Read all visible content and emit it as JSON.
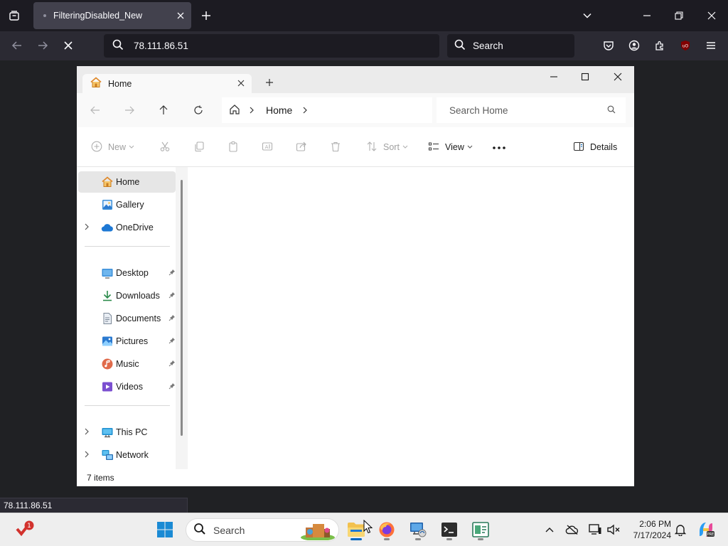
{
  "browser": {
    "tab_title": "FilteringDisabled_New",
    "url": "78.111.86.51",
    "search_placeholder": "Search",
    "status_url": "78.111.86.51"
  },
  "explorer": {
    "tab_title": "Home",
    "breadcrumb": "Home",
    "search_placeholder": "Search Home",
    "commands": {
      "new": "New",
      "sort": "Sort",
      "view": "View",
      "details": "Details"
    },
    "nav": {
      "home": "Home",
      "gallery": "Gallery",
      "onedrive": "OneDrive",
      "desktop": "Desktop",
      "downloads": "Downloads",
      "documents": "Documents",
      "pictures": "Pictures",
      "music": "Music",
      "videos": "Videos",
      "this_pc": "This PC",
      "network": "Network"
    },
    "status": "7 items"
  },
  "taskbar": {
    "search_label": "Search",
    "time": "2:06 PM",
    "date": "7/17/2024",
    "notification_badge": "1"
  },
  "colors": {
    "firefox_bg": "#1c1b22",
    "firefox_toolbar": "#2b2a33",
    "firefox_tab": "#42414d",
    "windows_accent": "#0067c0",
    "folder_yellow": "#f2c14e"
  }
}
